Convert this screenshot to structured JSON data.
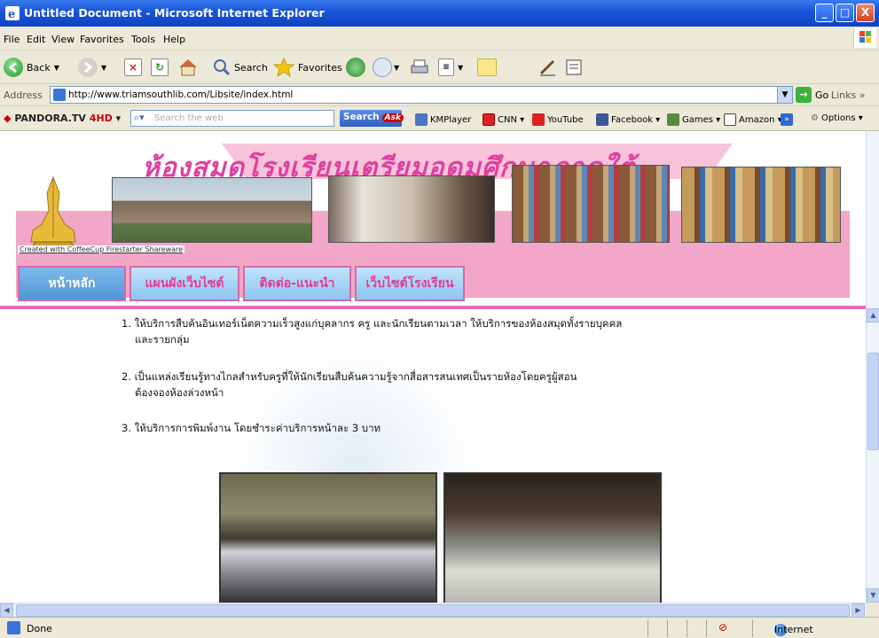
{
  "window": {
    "title": "Untitled Document - Microsoft Internet Explorer",
    "min": "_",
    "max": "□",
    "close": "X"
  },
  "menu": [
    "File",
    "Edit",
    "View",
    "Favorites",
    "Tools",
    "Help"
  ],
  "toolbar": {
    "back": "Back",
    "search": "Search",
    "favorites": "Favorites"
  },
  "address": {
    "label": "Address",
    "url": "http://www.triamsouthlib.com/Libsite/index.html",
    "go": "Go",
    "links": "Links »"
  },
  "pandora": {
    "brand_prefix": "PANDORA.TV",
    "brand_suffix": "4HD",
    "search_placeholder": "Search the web",
    "search_button": "Search",
    "ask": "Ask",
    "links": [
      "KMPlayer",
      "CNN ▾",
      "YouTube",
      "Facebook ▾",
      "Games ▾",
      "Amazon ▾"
    ],
    "options": "Options ▾"
  },
  "site": {
    "banner_title": "ห้องสมุดโรงเรียนเตรียมอุดมศึกษาภาคใต้",
    "credit": "Created with CoffeeCup Firestarter Shareware",
    "tabs": [
      "หน้าหลัก",
      "แผนผังเว็บไซต์",
      "ติดต่อ-แนะนำ",
      "เว็บไซต์โรงเรียน"
    ],
    "items": [
      "1. ให้บริการสืบค้นอินเทอร์เน็ตความเร็วสูงแก่บุคลากร ครู และนักเรียนตามเวลา  ให้บริการของห้องสมุดทั้งรายบุคคล",
      "และรายกลุ่ม",
      "2. เป็นแหล่งเรียนรู้ทางไกลสำหรับครูที่ให้นักเรียนสืบค้นความรู้จากสื่อสารสนเทศเป็นรายห้องโดยครูผู้สอน",
      "ต้องจองห้องล่วงหน้า",
      "3. ให้บริการการพิมพ์งาน โดยชำระค่าบริการหน้าละ 3 บาท"
    ]
  },
  "status": {
    "text": "Done",
    "zone": "Internet"
  }
}
